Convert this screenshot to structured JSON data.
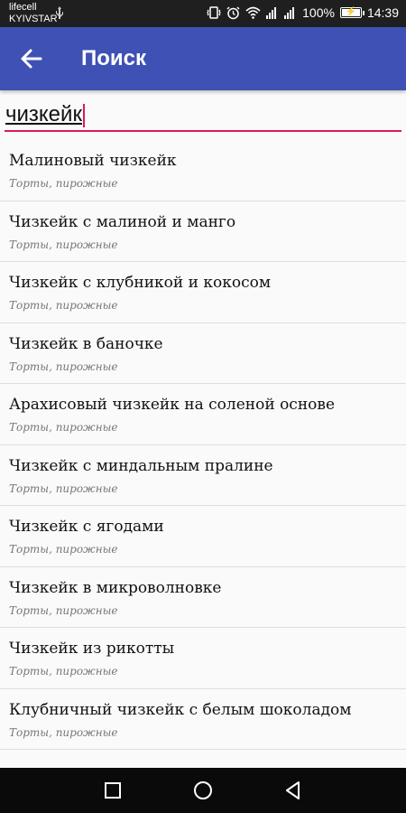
{
  "status_bar": {
    "carrier_1": "lifecell",
    "carrier_2": "KYIVSTAR",
    "battery": "100%",
    "battery_level": 1.0,
    "time": "14:39",
    "icons": [
      "usb-icon",
      "vibrate-icon",
      "alarm-icon",
      "wifi-icon",
      "signal-icon",
      "signal-icon",
      "battery-icon"
    ]
  },
  "app_bar": {
    "title": "Поиск",
    "back_icon": "arrow-back-icon",
    "color": "#3f51b5"
  },
  "search": {
    "value": "чизкейк",
    "accent": "#d81b60"
  },
  "results": [
    {
      "title": "Малиновый чизкейк",
      "category": "Торты, пирожные"
    },
    {
      "title": "Чизкейк с малиной и манго",
      "category": "Торты, пирожные"
    },
    {
      "title": "Чизкейк с клубникой и кокосом",
      "category": "Торты, пирожные"
    },
    {
      "title": "Чизкейк в баночке",
      "category": "Торты, пирожные"
    },
    {
      "title": "Арахисовый чизкейк на соленой основе",
      "category": "Торты, пирожные"
    },
    {
      "title": "Чизкейк с миндальным пралине",
      "category": "Торты, пирожные"
    },
    {
      "title": "Чизкейк с ягодами",
      "category": "Торты, пирожные"
    },
    {
      "title": "Чизкейк в микроволновке",
      "category": "Торты, пирожные"
    },
    {
      "title": "Чизкейк из рикотты",
      "category": "Торты, пирожные"
    },
    {
      "title": "Клубничный чизкейк с белым шоколадом",
      "category": "Торты, пирожные"
    }
  ],
  "nav_bar": {
    "icons": [
      "recents-square-icon",
      "home-circle-icon",
      "back-triangle-icon"
    ]
  }
}
